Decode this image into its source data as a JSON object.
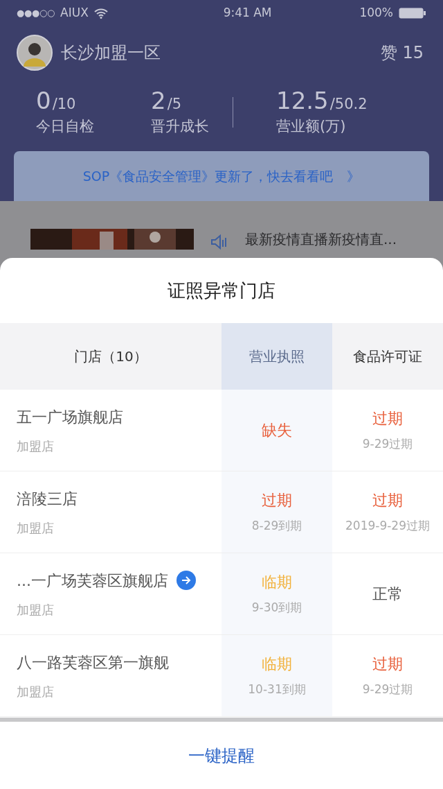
{
  "status_bar": {
    "signal": "●●●○○",
    "carrier": "AIUX",
    "time": "9:41 AM",
    "battery": "100%"
  },
  "profile": {
    "name": "长沙加盟一区",
    "likes": "赞 15"
  },
  "stats": [
    {
      "value": "0",
      "total": "/10",
      "label": "今日自检"
    },
    {
      "value": "2",
      "total": "/5",
      "label": "晋升成长"
    },
    {
      "value": "12.5",
      "total": "/50.2",
      "label": "营业额(万)"
    }
  ],
  "banner": {
    "text": "SOP《食品安全管理》更新了，快去看看吧",
    "arrow": "》"
  },
  "news": {
    "title": "最新疫情直播新疫情直..."
  },
  "sheet": {
    "title": "证照异常门店",
    "columns": [
      {
        "label": "门店（10）",
        "selected": false
      },
      {
        "label": "营业执照",
        "selected": true
      },
      {
        "label": "食品许可证",
        "selected": false
      }
    ],
    "rows": [
      {
        "name": "五一广场旗舰店",
        "type": "加盟店",
        "link": false,
        "license": {
          "kind": "missing",
          "text": "缺失"
        },
        "food": {
          "kind": "expired",
          "text": "过期",
          "note": "9-29过期"
        }
      },
      {
        "name": "涪陵三店",
        "type": "加盟店",
        "link": false,
        "license": {
          "kind": "expired",
          "text": "过期",
          "note": "8-29到期"
        },
        "food": {
          "kind": "expired",
          "text": "过期",
          "note": "2019-9-29过期"
        }
      },
      {
        "name": "...一广场芙蓉区旗舰店",
        "type": "加盟店",
        "link": true,
        "license": {
          "kind": "expiring",
          "text": "临期",
          "note": "9-30到期"
        },
        "food": {
          "kind": "normal",
          "text": "正常"
        }
      },
      {
        "name": "八一路芙蓉区第一旗舰",
        "type": "加盟店",
        "link": false,
        "license": {
          "kind": "expiring",
          "text": "临期",
          "note": "10-31到期"
        },
        "food": {
          "kind": "expired",
          "text": "过期",
          "note": "9-29过期"
        }
      }
    ],
    "button": "一键提醒"
  }
}
